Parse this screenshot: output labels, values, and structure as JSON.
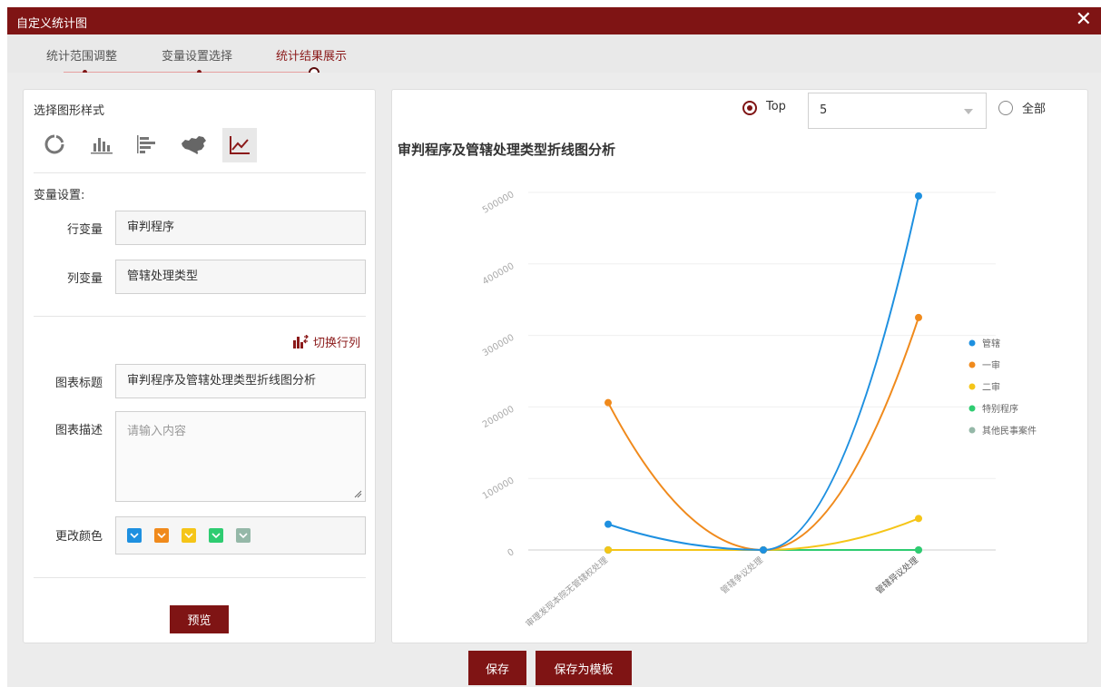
{
  "window": {
    "title": "自定义统计图",
    "close_glyph": "✕"
  },
  "steps": [
    {
      "label": "统计范围调整"
    },
    {
      "label": "变量设置选择"
    },
    {
      "label": "统计结果展示"
    }
  ],
  "left": {
    "style_heading": "选择图形样式",
    "style_icons": [
      "donut-icon",
      "bar-chart-icon",
      "horizontal-bar-icon",
      "china-map-icon",
      "line-chart-icon"
    ],
    "var_heading": "变量设置:",
    "row_var_label": "行变量",
    "row_var_value": "审判程序",
    "col_var_label": "列变量",
    "col_var_value": "管辖处理类型",
    "switch_label": "切换行列",
    "chart_title_label": "图表标题",
    "chart_title_value": "审判程序及管辖处理类型折线图分析",
    "chart_desc_label": "图表描述",
    "chart_desc_placeholder": "请输入内容",
    "color_label": "更改颜色",
    "colors": [
      "#1e90e0",
      "#f08a1c",
      "#f5c518",
      "#2ecc71",
      "#95b8a8"
    ],
    "preview_label": "预览"
  },
  "right": {
    "top_label": "Top",
    "top_value": "5",
    "all_label": "全部",
    "top_selected": true
  },
  "footer": {
    "save_label": "保存",
    "save_template_label": "保存为模板"
  },
  "chart_data": {
    "type": "line",
    "title": "审判程序及管辖处理类型折线图分析",
    "categories": [
      "审理发现本院无管辖权处理",
      "管辖争议处理",
      "管辖异议处理"
    ],
    "ylim": [
      0,
      500000
    ],
    "yticks": [
      0,
      100000,
      200000,
      300000,
      400000,
      500000
    ],
    "grid": true,
    "legend_position": "right",
    "series": [
      {
        "name": "管辖",
        "color": "#1e90e0",
        "values": [
          36000,
          0,
          495000
        ]
      },
      {
        "name": "一审",
        "color": "#f08a1c",
        "values": [
          206000,
          0,
          325000
        ]
      },
      {
        "name": "二审",
        "color": "#f5c518",
        "values": [
          0,
          0,
          44000
        ]
      },
      {
        "name": "特别程序",
        "color": "#2ecc71",
        "values": [
          0,
          0,
          0
        ]
      },
      {
        "name": "其他民事案件",
        "color": "#95b8a8",
        "values": [
          0,
          0,
          0
        ]
      }
    ]
  }
}
